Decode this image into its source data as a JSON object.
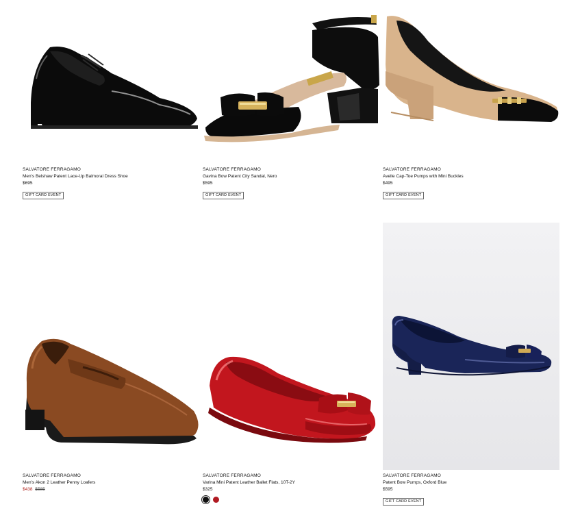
{
  "products": [
    {
      "brand": "SALVATORE FERRAGAMO",
      "title": "Men's Belshaw Patent Lace-Up Balmoral Dress Shoe",
      "price": "$695",
      "badge": "GIFT CARD EVENT",
      "image": "black-patent-oxford-shoe"
    },
    {
      "brand": "SALVATORE FERRAGAMO",
      "title": "Gavina Bow Patent City Sandal, Nero",
      "price": "$595",
      "badge": "GIFT CARD EVENT",
      "image": "black-ankle-strap-bow-sandal"
    },
    {
      "brand": "SALVATORE FERRAGAMO",
      "title": "Avelle Cap-Toe Pumps with Mini Buckles",
      "price": "$495",
      "badge": "GIFT CARD EVENT",
      "image": "tan-cap-toe-pump"
    },
    {
      "brand": "SALVATORE FERRAGAMO",
      "title": "Men's Akon 2 Leather Penny Loafers",
      "sale_price": "$438",
      "original_price": "$585",
      "image": "brown-penny-loafer"
    },
    {
      "brand": "SALVATORE FERRAGAMO",
      "title": "Varina Mini Patent Leather Ballet Flats, 10T-2Y",
      "price": "$325",
      "image": "red-bow-ballet-flat",
      "swatches": [
        {
          "color": "#111111",
          "selected": true
        },
        {
          "color": "#b01a22",
          "selected": false
        }
      ]
    },
    {
      "brand": "SALVATORE FERRAGAMO",
      "title": "Patent Bow Pumps, Oxford Blue",
      "price": "$595",
      "badge": "GIFT CARD EVENT",
      "image": "navy-bow-pump"
    }
  ]
}
